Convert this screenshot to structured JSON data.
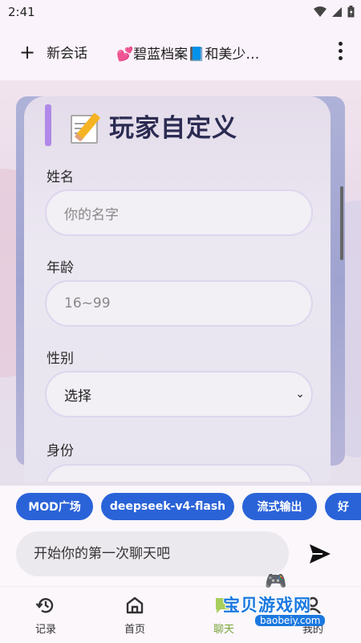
{
  "status_bar": {
    "time": "2:41"
  },
  "app_bar": {
    "new_chat_label": "新会话",
    "chat_title": "💕碧蓝档案📘和美少…"
  },
  "form": {
    "title": "玩家自定义",
    "fields": [
      {
        "label": "姓名",
        "placeholder": "你的名字"
      },
      {
        "label": "年龄",
        "placeholder": "16~99"
      },
      {
        "label": "性别",
        "value": "选择"
      },
      {
        "label": "身份"
      }
    ]
  },
  "chips": [
    "MOD广场",
    "deepseek-v4-flash",
    "流式输出",
    "好"
  ],
  "chat_input": {
    "placeholder": "开始你的第一次聊天吧"
  },
  "bottom_nav": [
    {
      "label": "记录",
      "icon": "history-icon"
    },
    {
      "label": "首页",
      "icon": "home-icon"
    },
    {
      "label": "聊天",
      "icon": "chat-icon",
      "active": true
    },
    {
      "label": "我的",
      "icon": "person-icon"
    }
  ],
  "watermark": {
    "title": "宝贝游戏网",
    "url": "baobeiy.com"
  },
  "colors": {
    "accent": "#2a63d8",
    "title_bar": "#b088e8",
    "active_nav": "#7aa53a"
  }
}
